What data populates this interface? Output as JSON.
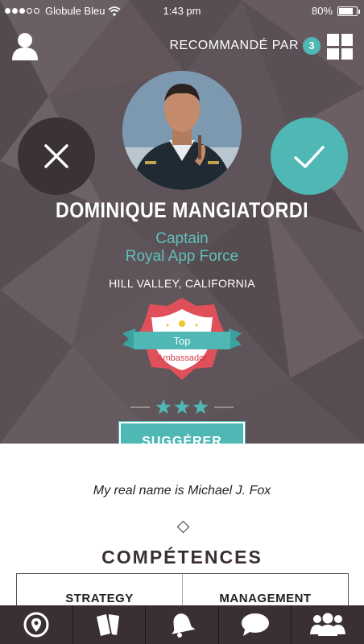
{
  "status_bar": {
    "carrier": "Globule Bleu",
    "time": "1:43 pm",
    "battery": "80%",
    "battery_level": 0.8
  },
  "header": {
    "recommended_label": "RECOMMANDÉ PAR",
    "recommended_count": "3"
  },
  "profile": {
    "name": "DOMINIQUE MANGIATORDI",
    "role_line1": "Captain",
    "role_line2": "Royal App Force",
    "location": "HILL VALLEY, CALIFORNIA"
  },
  "badge": {
    "label_top": "Top",
    "label_bottom": "Ambassador"
  },
  "rating": {
    "stars": 3
  },
  "actions": {
    "suggest_label": "SUGGÉRER"
  },
  "bio": {
    "text": "My real name is  Michael J. Fox"
  },
  "skills": {
    "title": "COMPÉTENCES",
    "items": [
      "STRATEGY",
      "MANAGEMENT"
    ]
  },
  "tabs": [
    {
      "icon": "map-pin-icon"
    },
    {
      "icon": "cards-icon"
    },
    {
      "icon": "bell-icon"
    },
    {
      "icon": "chat-bubble-icon"
    },
    {
      "icon": "group-icon"
    }
  ],
  "colors": {
    "accent": "#4fb7b4",
    "dark": "#3b3031",
    "hero_bg": "#5e5459",
    "badge_red": "#e0505a"
  }
}
